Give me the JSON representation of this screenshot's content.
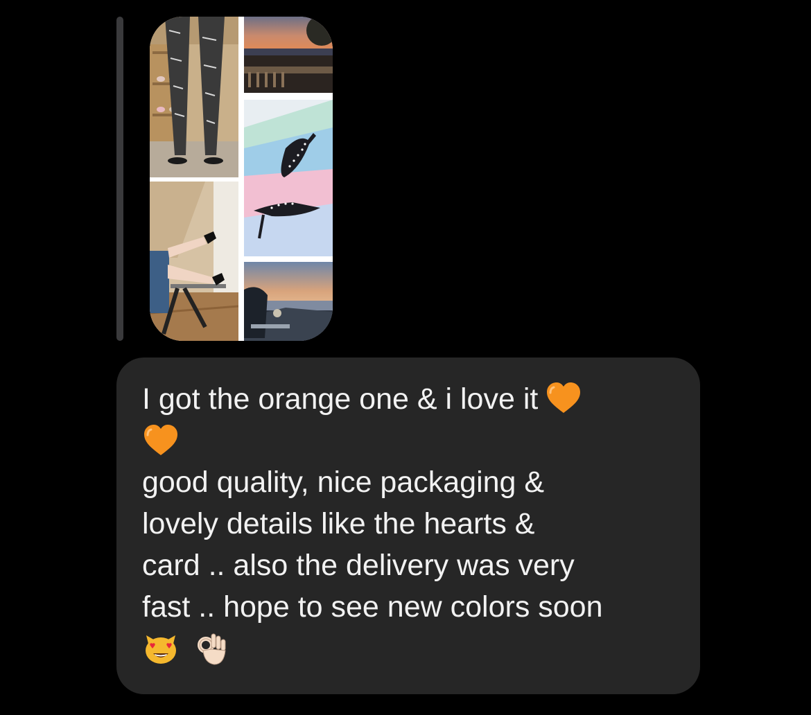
{
  "thread": {
    "reply_indicator": "story-reply-bar",
    "story_preview": {
      "tiles": [
        {
          "name": "tile-model-patterned-pants",
          "icon": "photo-model-pants"
        },
        {
          "name": "tile-legs-on-stool",
          "icon": "photo-legs-heels"
        },
        {
          "name": "tile-sunset-terrace",
          "icon": "photo-sunset"
        },
        {
          "name": "tile-heels-pastel-backdrop",
          "icon": "photo-heels-pastel"
        },
        {
          "name": "tile-car-ocean-view",
          "icon": "photo-car-sea"
        }
      ]
    },
    "message": {
      "lines": [
        "I got the orange one & i love it",
        "good quality, nice packaging &",
        "lovely details like the hearts &",
        "card .. also the delivery was very",
        "fast .. hope to see new colors soon"
      ],
      "emojis": {
        "heart_1": "orange-heart-emoji",
        "heart_2": "orange-heart-emoji",
        "cat": "heart-eyes-cat-emoji",
        "ok": "ok-hand-emoji"
      },
      "colors": {
        "bubble": "#262626",
        "text": "#f2f2f2",
        "heart": "#f7921e"
      }
    }
  }
}
